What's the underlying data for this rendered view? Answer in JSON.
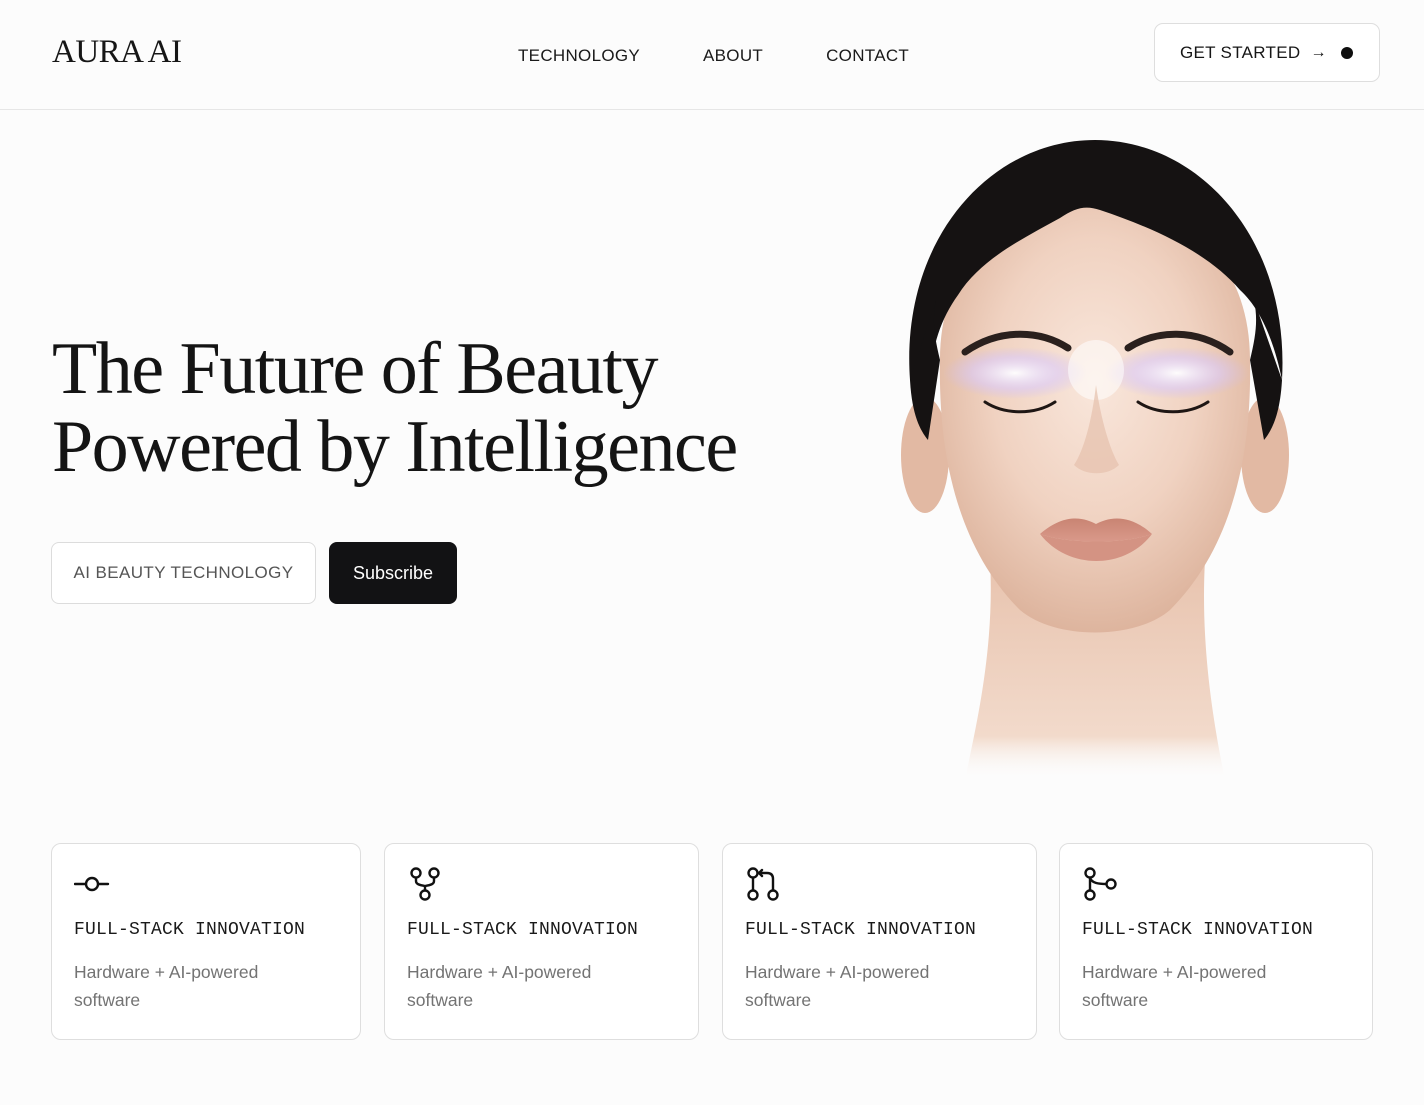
{
  "brand": {
    "logo": "AURA AI"
  },
  "nav": {
    "items": [
      {
        "label": "TECHNOLOGY"
      },
      {
        "label": "ABOUT"
      },
      {
        "label": "CONTACT"
      }
    ],
    "cta_label": "GET STARTED",
    "cta_arrow": "→"
  },
  "hero": {
    "title_line1": "The Future of Beauty",
    "title_line2": "Powered by Intelligence",
    "chip_label": "AI BEAUTY TECHNOLOGY",
    "subscribe_label": "Subscribe"
  },
  "features": [
    {
      "icon": "commit-icon",
      "title": "FULL-STACK INNOVATION",
      "description": "Hardware + AI-powered software"
    },
    {
      "icon": "fork-icon",
      "title": "FULL-STACK INNOVATION",
      "description": "Hardware + AI-powered software"
    },
    {
      "icon": "pull-request-icon",
      "title": "FULL-STACK INNOVATION",
      "description": "Hardware + AI-powered software"
    },
    {
      "icon": "branch-icon",
      "title": "FULL-STACK INNOVATION",
      "description": "Hardware + AI-powered software"
    }
  ],
  "colors": {
    "background": "#fcfcfc",
    "primary_button": "#121214",
    "text_dark": "#141414",
    "text_muted": "#737373"
  }
}
